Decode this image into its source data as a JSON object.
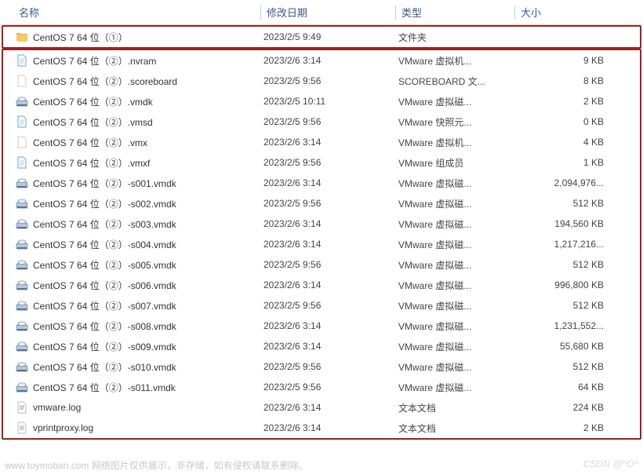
{
  "columns": {
    "name": "名称",
    "date": "修改日期",
    "type": "类型",
    "size": "大小"
  },
  "icons": {
    "folder": "folder",
    "doc": "doc",
    "blank": "blank",
    "disk": "disk",
    "text": "text"
  },
  "highlighted_row": {
    "icon": "folder",
    "name": "CentOS 7 64 位（①）",
    "date": "2023/2/5 9:49",
    "type": "文件夹",
    "size": ""
  },
  "rows": [
    {
      "icon": "doc",
      "name": "CentOS 7 64 位（②）.nvram",
      "date": "2023/2/6 3:14",
      "type": "VMware 虚拟机...",
      "size": "9 KB"
    },
    {
      "icon": "blank",
      "name": "CentOS 7 64 位（②）.scoreboard",
      "date": "2023/2/5 9:56",
      "type": "SCOREBOARD 文...",
      "size": "8 KB"
    },
    {
      "icon": "disk",
      "name": "CentOS 7 64 位（②）.vmdk",
      "date": "2023/2/5 10:11",
      "type": "VMware 虚拟磁...",
      "size": "2 KB"
    },
    {
      "icon": "doc",
      "name": "CentOS 7 64 位（②）.vmsd",
      "date": "2023/2/5 9:56",
      "type": "VMware 快照元...",
      "size": "0 KB"
    },
    {
      "icon": "blank",
      "name": "CentOS 7 64 位（②）.vmx",
      "date": "2023/2/6 3:14",
      "type": "VMware 虚拟机...",
      "size": "4 KB"
    },
    {
      "icon": "doc",
      "name": "CentOS 7 64 位（②）.vmxf",
      "date": "2023/2/5 9:56",
      "type": "VMware 组成员",
      "size": "1 KB"
    },
    {
      "icon": "disk",
      "name": "CentOS 7 64 位（②）-s001.vmdk",
      "date": "2023/2/6 3:14",
      "type": "VMware 虚拟磁...",
      "size": "2,094,976..."
    },
    {
      "icon": "disk",
      "name": "CentOS 7 64 位（②）-s002.vmdk",
      "date": "2023/2/5 9:56",
      "type": "VMware 虚拟磁...",
      "size": "512 KB"
    },
    {
      "icon": "disk",
      "name": "CentOS 7 64 位（②）-s003.vmdk",
      "date": "2023/2/6 3:14",
      "type": "VMware 虚拟磁...",
      "size": "194,560 KB"
    },
    {
      "icon": "disk",
      "name": "CentOS 7 64 位（②）-s004.vmdk",
      "date": "2023/2/6 3:14",
      "type": "VMware 虚拟磁...",
      "size": "1,217,216..."
    },
    {
      "icon": "disk",
      "name": "CentOS 7 64 位（②）-s005.vmdk",
      "date": "2023/2/5 9:56",
      "type": "VMware 虚拟磁...",
      "size": "512 KB"
    },
    {
      "icon": "disk",
      "name": "CentOS 7 64 位（②）-s006.vmdk",
      "date": "2023/2/6 3:14",
      "type": "VMware 虚拟磁...",
      "size": "996,800 KB"
    },
    {
      "icon": "disk",
      "name": "CentOS 7 64 位（②）-s007.vmdk",
      "date": "2023/2/5 9:56",
      "type": "VMware 虚拟磁...",
      "size": "512 KB"
    },
    {
      "icon": "disk",
      "name": "CentOS 7 64 位（②）-s008.vmdk",
      "date": "2023/2/6 3:14",
      "type": "VMware 虚拟磁...",
      "size": "1,231,552..."
    },
    {
      "icon": "disk",
      "name": "CentOS 7 64 位（②）-s009.vmdk",
      "date": "2023/2/6 3:14",
      "type": "VMware 虚拟磁...",
      "size": "55,680 KB"
    },
    {
      "icon": "disk",
      "name": "CentOS 7 64 位（②）-s010.vmdk",
      "date": "2023/2/5 9:56",
      "type": "VMware 虚拟磁...",
      "size": "512 KB"
    },
    {
      "icon": "disk",
      "name": "CentOS 7 64 位（②）-s011.vmdk",
      "date": "2023/2/5 9:56",
      "type": "VMware 虚拟磁...",
      "size": "64 KB"
    },
    {
      "icon": "text",
      "name": "vmware.log",
      "date": "2023/2/6 3:14",
      "type": "文本文档",
      "size": "224 KB"
    },
    {
      "icon": "text",
      "name": "vprintproxy.log",
      "date": "2023/2/6 3:14",
      "type": "文本文档",
      "size": "2 KB"
    }
  ],
  "footer": {
    "left": "www.toymoban.com  网络图片仅供展示，非存储，如有侵权请联系删除。",
    "right": "CSDN @^O^"
  }
}
